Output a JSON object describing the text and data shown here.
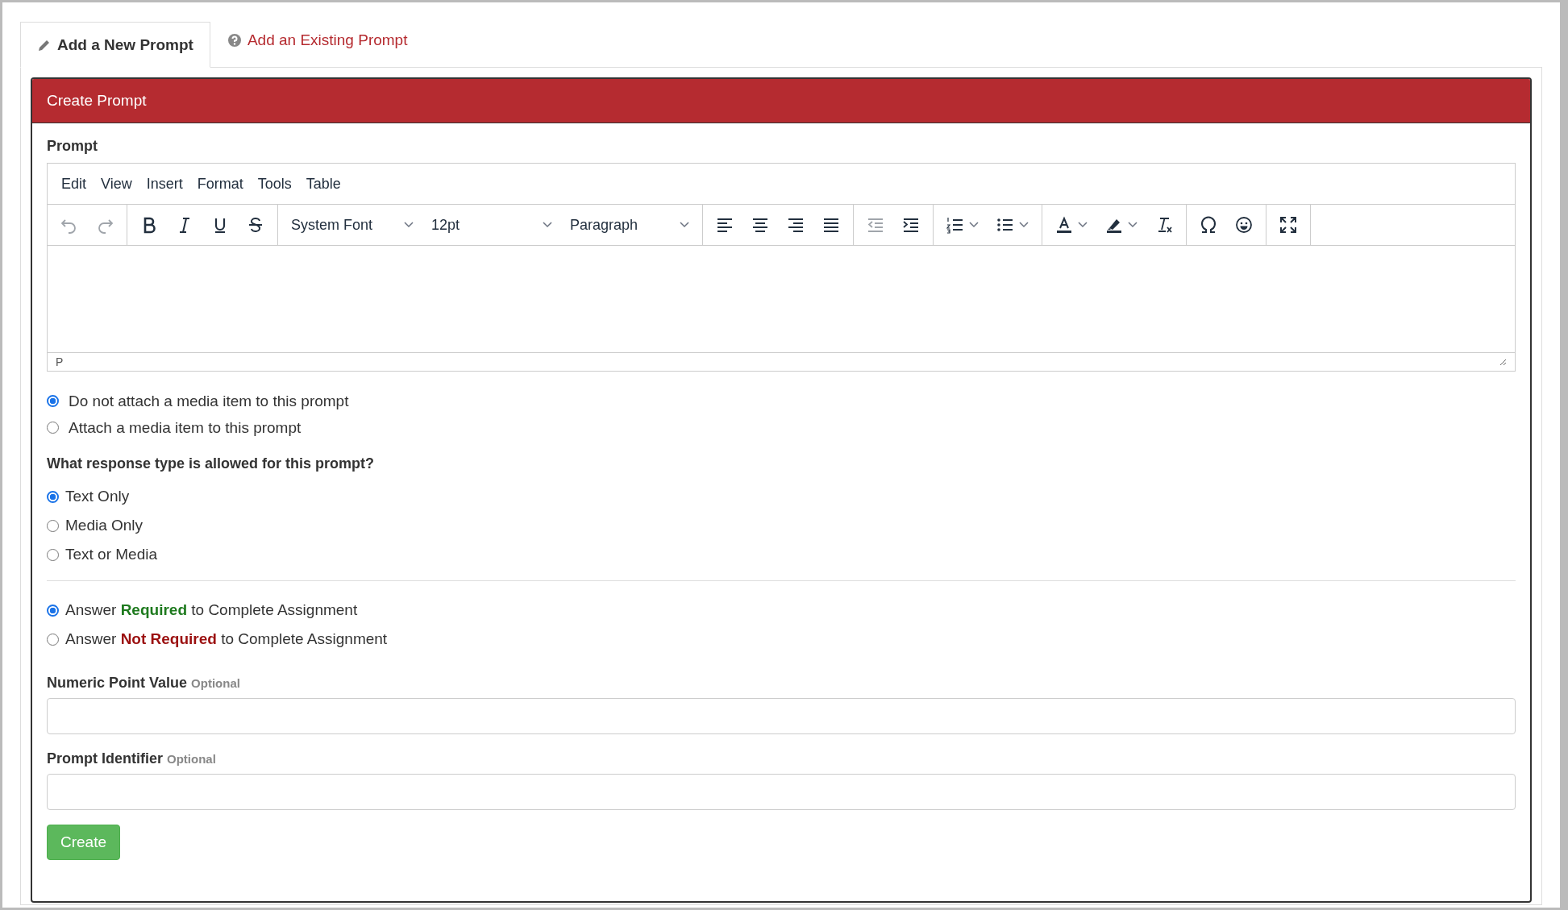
{
  "tabs": [
    {
      "label": "Add a New Prompt",
      "selected": true
    },
    {
      "label": "Add an Existing Prompt",
      "selected": false
    }
  ],
  "panel": {
    "title": "Create Prompt"
  },
  "editor": {
    "label": "Prompt",
    "menu": [
      "Edit",
      "View",
      "Insert",
      "Format",
      "Tools",
      "Table"
    ],
    "toolbar": [
      [
        {
          "kind": "undo",
          "disabled": true
        },
        {
          "kind": "redo",
          "disabled": true
        }
      ],
      [
        {
          "kind": "bold",
          "disabled": false
        },
        {
          "kind": "italic",
          "disabled": false
        },
        {
          "kind": "underline",
          "disabled": false
        },
        {
          "kind": "strike",
          "disabled": false
        }
      ],
      [
        {
          "kind": "select",
          "value": "System Font"
        },
        {
          "kind": "select",
          "value": "12pt"
        },
        {
          "kind": "select",
          "value": "Paragraph"
        }
      ],
      [
        {
          "kind": "align-left",
          "disabled": false
        },
        {
          "kind": "align-center",
          "disabled": false
        },
        {
          "kind": "align-right",
          "disabled": false
        },
        {
          "kind": "justify",
          "disabled": false
        }
      ],
      [
        {
          "kind": "outdent",
          "disabled": true
        },
        {
          "kind": "indent",
          "disabled": false
        }
      ],
      [
        {
          "kind": "numbered-list",
          "disabled": false
        },
        {
          "kind": "bullet-list",
          "disabled": false
        }
      ],
      [
        {
          "kind": "text-color",
          "disabled": false
        },
        {
          "kind": "highlight",
          "disabled": false
        },
        {
          "kind": "clear-format",
          "disabled": false
        }
      ],
      [
        {
          "kind": "omega",
          "disabled": false
        },
        {
          "kind": "emoji",
          "disabled": false
        }
      ],
      [
        {
          "kind": "fullscreen",
          "disabled": false
        }
      ]
    ],
    "status_path": "P"
  },
  "media_options": [
    {
      "label": "Do not attach a media item to this prompt",
      "selected": true
    },
    {
      "label": "Attach a media item to this prompt",
      "selected": false
    }
  ],
  "response_question": "What response type is allowed for this prompt?",
  "response_types": [
    {
      "label": "Text Only",
      "selected": true
    },
    {
      "label": "Media Only",
      "selected": false
    },
    {
      "label": "Text or Media",
      "selected": false
    }
  ],
  "requirement_options": [
    {
      "before": "Answer ",
      "emphasis": "Required",
      "after": " to Complete Assignment",
      "color": "#1e7a1e",
      "selected": true
    },
    {
      "before": "Answer ",
      "emphasis": "Not Required",
      "after": " to Complete Assignment",
      "color": "#9b1010",
      "selected": false
    }
  ],
  "fields": [
    {
      "label": "Numeric Point Value",
      "hint": "Optional"
    },
    {
      "label": "Prompt Identifier",
      "hint": "Optional"
    }
  ],
  "submit": "Create"
}
